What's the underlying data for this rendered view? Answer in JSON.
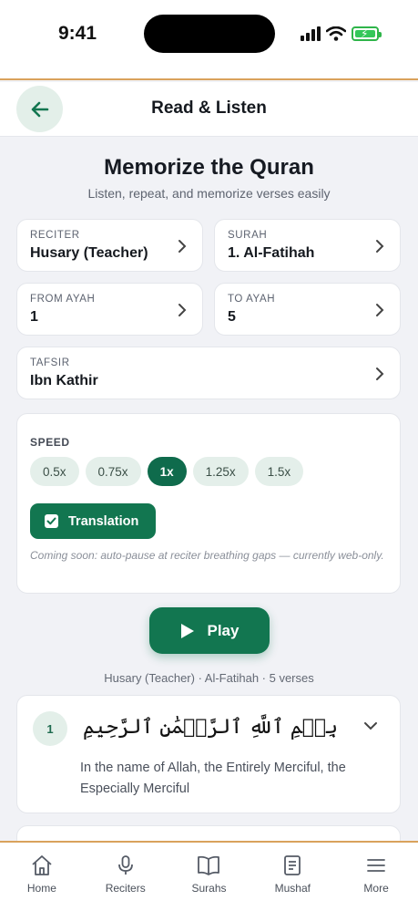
{
  "status": {
    "time": "9:41"
  },
  "header": {
    "title": "Read & Listen"
  },
  "hero": {
    "title": "Memorize the Quran",
    "subtitle": "Listen, repeat, and memorize verses easily"
  },
  "selectors": {
    "reciter": {
      "label": "RECITER",
      "value": "Husary (Teacher)"
    },
    "surah": {
      "label": "SURAH",
      "value": "1. Al-Fatihah"
    },
    "from_ayah": {
      "label": "FROM AYAH",
      "value": "1"
    },
    "to_ayah": {
      "label": "TO AYAH",
      "value": "5"
    },
    "tafsir": {
      "label": "TAFSIR",
      "value": "Ibn Kathir"
    }
  },
  "speed": {
    "label": "SPEED",
    "options": [
      "0.5x",
      "0.75x",
      "1x",
      "1.25x",
      "1.5x"
    ],
    "selected": "1x"
  },
  "translation_toggle": {
    "label": "Translation",
    "checked": true
  },
  "note": "Coming soon: auto-pause at reciter breathing gaps — currently web-only.",
  "player": {
    "play_label": "Play",
    "meta": "Husary (Teacher) · Al-Fatihah · 5 verses"
  },
  "verses": [
    {
      "number": "1",
      "arabic": "بِسۡمِ ٱللَّهِ ٱلرَّحۡمَٰنِ ٱلرَّحِيمِ",
      "translation": "In the name of Allah, the Entirely Merciful, the Especially Merciful"
    }
  ],
  "tabs": [
    {
      "label": "Home",
      "icon": "home-icon"
    },
    {
      "label": "Reciters",
      "icon": "microphone-icon"
    },
    {
      "label": "Surahs",
      "icon": "book-open-icon"
    },
    {
      "label": "Mushaf",
      "icon": "mushaf-icon"
    },
    {
      "label": "More",
      "icon": "menu-icon"
    }
  ],
  "colors": {
    "primary": "#127650",
    "accent_border": "#d9a25c",
    "background": "#f1f2f6",
    "pill_bg": "#e4efea"
  }
}
